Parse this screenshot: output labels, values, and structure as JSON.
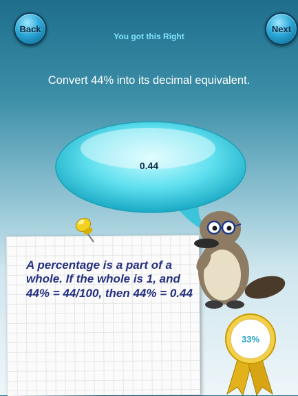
{
  "nav": {
    "back_label": "Back",
    "next_label": "Next"
  },
  "status": {
    "text": "You got this Right"
  },
  "question": {
    "text": "Convert 44% into its decimal equivalent."
  },
  "answer": {
    "value": "0.44"
  },
  "hint": {
    "text": "A percentage is a part of a whole. If the whole is 1, and 44% = 44/100, then 44% = 0.44"
  },
  "score": {
    "text": "33%"
  },
  "icons": {
    "pin": "push-pin-icon",
    "mascot": "platypus-icon",
    "award": "award-ribbon-icon"
  },
  "colors": {
    "bubble": "#5fe0ef",
    "hint_text": "#25307e",
    "status_text": "#7fe3ff",
    "ribbon_gold": "#e8b820"
  }
}
